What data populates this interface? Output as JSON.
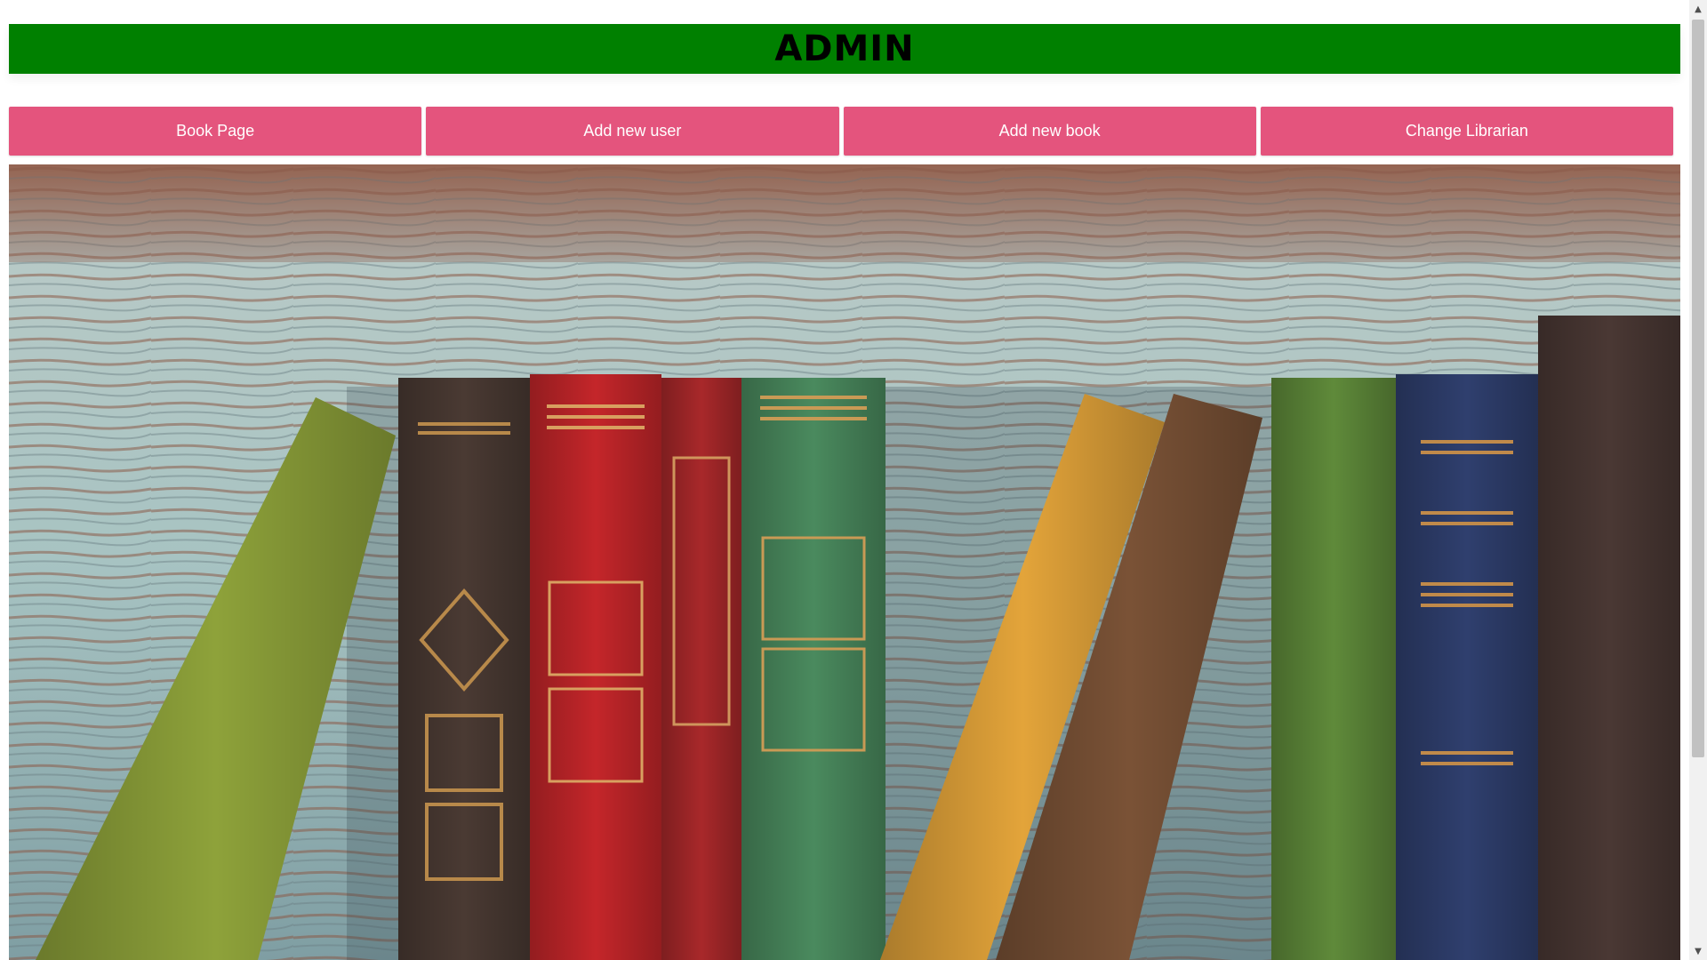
{
  "header": {
    "title": "ADMIN",
    "background_color": "#008000"
  },
  "nav": {
    "button_color": "#e4547d",
    "buttons": [
      {
        "label": "Book Page"
      },
      {
        "label": "Add new user"
      },
      {
        "label": "Add new book"
      },
      {
        "label": "Change Librarian"
      }
    ]
  },
  "hero": {
    "subject": "books-on-shelf-image",
    "book_colors": [
      "#8ea23a",
      "#4a3a33",
      "#c4262a",
      "#a8282a",
      "#4a8a5e",
      "#e3a43a",
      "#7a5236",
      "#5f8a3a",
      "#2f3f6e",
      "#4a3834"
    ]
  },
  "scrollbar": {
    "up_icon": "triangle-up-icon",
    "down_icon": "triangle-down-icon"
  }
}
